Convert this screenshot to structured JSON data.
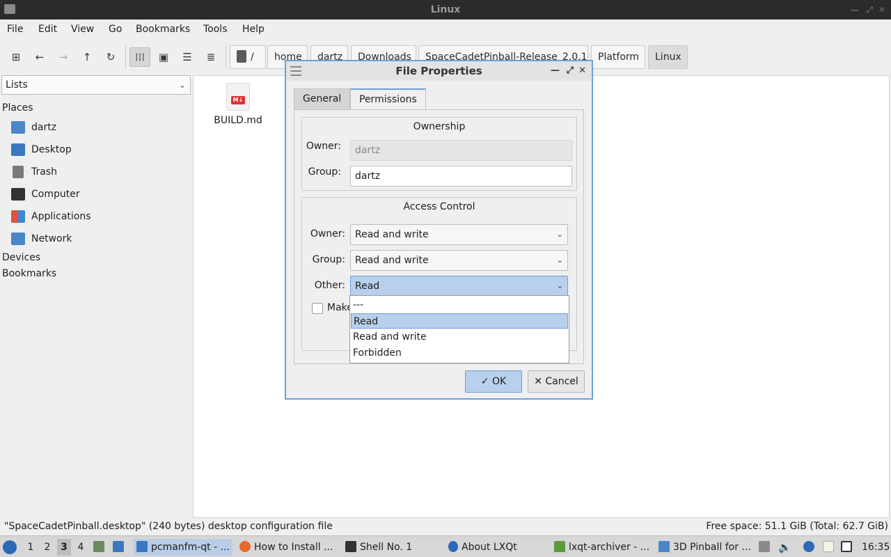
{
  "window": {
    "title": "Linux"
  },
  "menubar": [
    "File",
    "Edit",
    "View",
    "Go",
    "Bookmarks",
    "Tools",
    "Help"
  ],
  "toolbar": {
    "root": "/",
    "breadcrumbs": [
      "home",
      "dartz",
      "Downloads",
      "SpaceCadetPinball-Release_2.0.1",
      "Platform",
      "Linux"
    ]
  },
  "sidebar": {
    "combo": "Lists",
    "places_header": "Places",
    "places": [
      "dartz",
      "Desktop",
      "Trash",
      "Computer",
      "Applications",
      "Network"
    ],
    "devices_header": "Devices",
    "bookmarks_header": "Bookmarks"
  },
  "files": [
    {
      "name": "BUILD.md",
      "badge": "M↓"
    }
  ],
  "statusbar": {
    "left": "\"SpaceCadetPinball.desktop\" (240 bytes) desktop configuration file",
    "right": "Free space: 51.1 GiB (Total: 62.7 GiB)"
  },
  "dialog": {
    "title": "File Properties",
    "tabs": [
      "General",
      "Permissions"
    ],
    "ownership": {
      "title": "Ownership",
      "owner_label": "Owner:",
      "owner_value": "dartz",
      "group_label": "Group:",
      "group_value": "dartz"
    },
    "access": {
      "title": "Access Control",
      "owner_label": "Owner:",
      "owner_value": "Read and write",
      "group_label": "Group:",
      "group_value": "Read and write",
      "other_label": "Other:",
      "other_value": "Read",
      "checkbox_label": "Make"
    },
    "dropdown_options": [
      "---",
      "Read",
      "Read and write",
      "Forbidden"
    ],
    "ok_label": "OK",
    "cancel_label": "Cancel"
  },
  "taskbar": {
    "desktops": [
      "1",
      "2",
      "3",
      "4"
    ],
    "active_desktop": "3",
    "tasks": [
      "pcmanfm-qt - ...",
      "How to Install ...",
      "Shell No. 1",
      "About LXQt",
      "lxqt-archiver - ...",
      "3D Pinball for ..."
    ],
    "clock": "16:35"
  },
  "colors": {
    "accent": "#6c9fd8",
    "selection": "#b9d0ec",
    "titlebar": "#2b2b2b"
  }
}
